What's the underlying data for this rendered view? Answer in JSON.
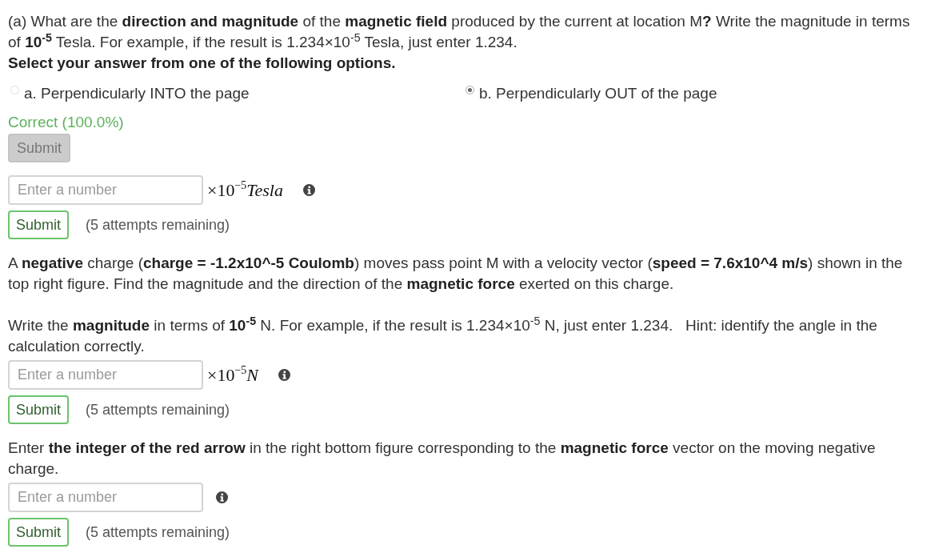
{
  "items": [
    {
      "kind": "prompt",
      "paragraphs": [
        "(a) What are the **direction and magnitude** of the **magnetic field** produced by the current at location M**?** Write the magnitude in terms of **10$^{-5}$** Tesla. For example, if the result is 1.234×10$^{-5}$ Tesla, just enter 1.234."
      ]
    },
    {
      "kind": "instruction",
      "text": "Select your answer from one of the following options."
    },
    {
      "kind": "choices",
      "options": [
        {
          "label": "a. Perpendicularly INTO the page",
          "selected": false
        },
        {
          "label": "b. Perpendicularly OUT of the page",
          "selected": true
        }
      ]
    },
    {
      "kind": "feedback",
      "text": "Correct (100.0%)"
    },
    {
      "kind": "submit",
      "label": "Submit",
      "disabled": true
    },
    {
      "kind": "answer",
      "placeholder": "Enter a number",
      "unit": "×10$^{−5}$*Tesla*",
      "submit": {
        "label": "Submit",
        "disabled": false
      },
      "attempts": "(5 attempts remaining)"
    },
    {
      "kind": "prompt",
      "paragraphs": [
        "A **negative** charge (**charge = -1.2x10^-5 Coulomb**) moves pass point M with a velocity vector (**speed = 7.6x10^4 m/s**) shown in the top right figure. Find the magnitude and the direction of the **magnetic force** exerted on this charge.",
        "Write the **magnitude** in terms of **10$^{-5}$** N. For example, if the result is 1.234×10$^{-5}$ N, just enter 1.234.   Hint: identify the angle in the calculation correctly."
      ]
    },
    {
      "kind": "answer",
      "placeholder": "Enter a number",
      "unit": "×10$^{−5}$*N*",
      "submit": {
        "label": "Submit",
        "disabled": false
      },
      "attempts": "(5 attempts remaining)"
    },
    {
      "kind": "prompt",
      "paragraphs": [
        "Enter **the integer of the red arrow** in the right bottom figure corresponding to the **magnetic force** vector on the moving negative charge."
      ]
    },
    {
      "kind": "answer",
      "placeholder": "Enter a number",
      "submit": {
        "label": "Submit",
        "disabled": false
      },
      "attempts": "(5 attempts remaining)"
    }
  ]
}
